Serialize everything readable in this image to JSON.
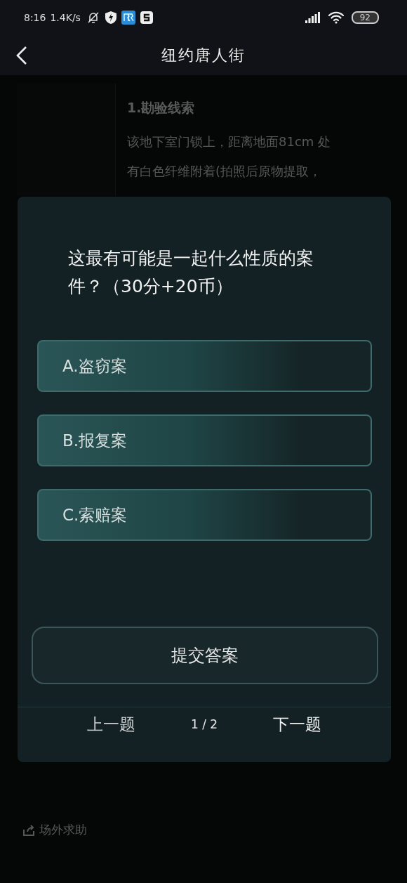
{
  "status_bar": {
    "time": "8:16",
    "speed": "1.4K/s",
    "battery": "92"
  },
  "header": {
    "title": "纽约唐人街"
  },
  "background": {
    "section_title": "1.勘验线索",
    "lines": [
      "该地下室门锁上，距离地面81cm 处",
      "有白色纤维附着(拍照后原物提取，"
    ],
    "help_button": "场外求助"
  },
  "dialog": {
    "question": "这最有可能是一起什么性质的案件？（30分+20币）",
    "options": [
      {
        "label": "A.盗窃案"
      },
      {
        "label": "B.报复案"
      },
      {
        "label": "C.索赔案"
      }
    ],
    "submit": "提交答案",
    "prev": "上一题",
    "page": "1 / 2",
    "next": "下一题"
  }
}
